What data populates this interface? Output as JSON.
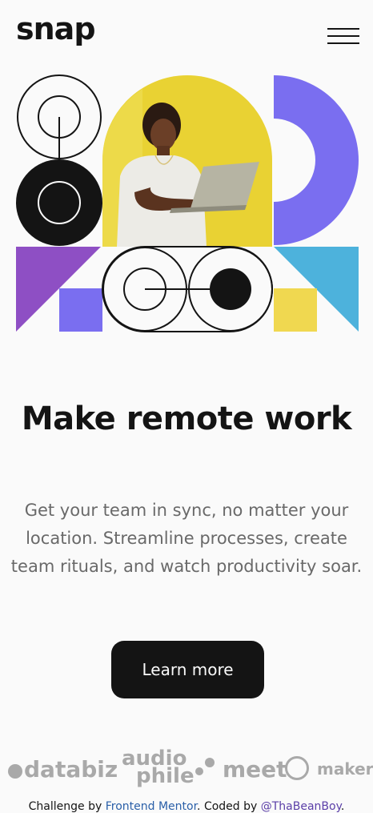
{
  "brand": {
    "logo": "snap"
  },
  "nav": {
    "menu_icon": "hamburger-menu-icon"
  },
  "hero": {
    "headline": "Make remote work",
    "description": "Get your team in sync, no matter your location. Streamline processes, create team rituals, and watch productivity soar.",
    "cta_label": "Learn more"
  },
  "clients": {
    "databiz": "databiz",
    "audiophile_top": "audio",
    "audiophile_bottom": "phile",
    "meet": "meet",
    "maker": "maker"
  },
  "footer": {
    "prefix": "Challenge by ",
    "challenge_link": "Frontend Mentor",
    "middle": ". Coded by ",
    "author_link": "@ThaBeanBoy",
    "suffix": "."
  },
  "colors": {
    "text_dark": "#141414",
    "text_muted": "#696969",
    "background": "#fafafa",
    "yellow": "#e9d233",
    "purple": "#7a6ef0",
    "violet": "#8e4fc4",
    "sky": "#4db2dc",
    "light_yellow": "#f0d850"
  }
}
